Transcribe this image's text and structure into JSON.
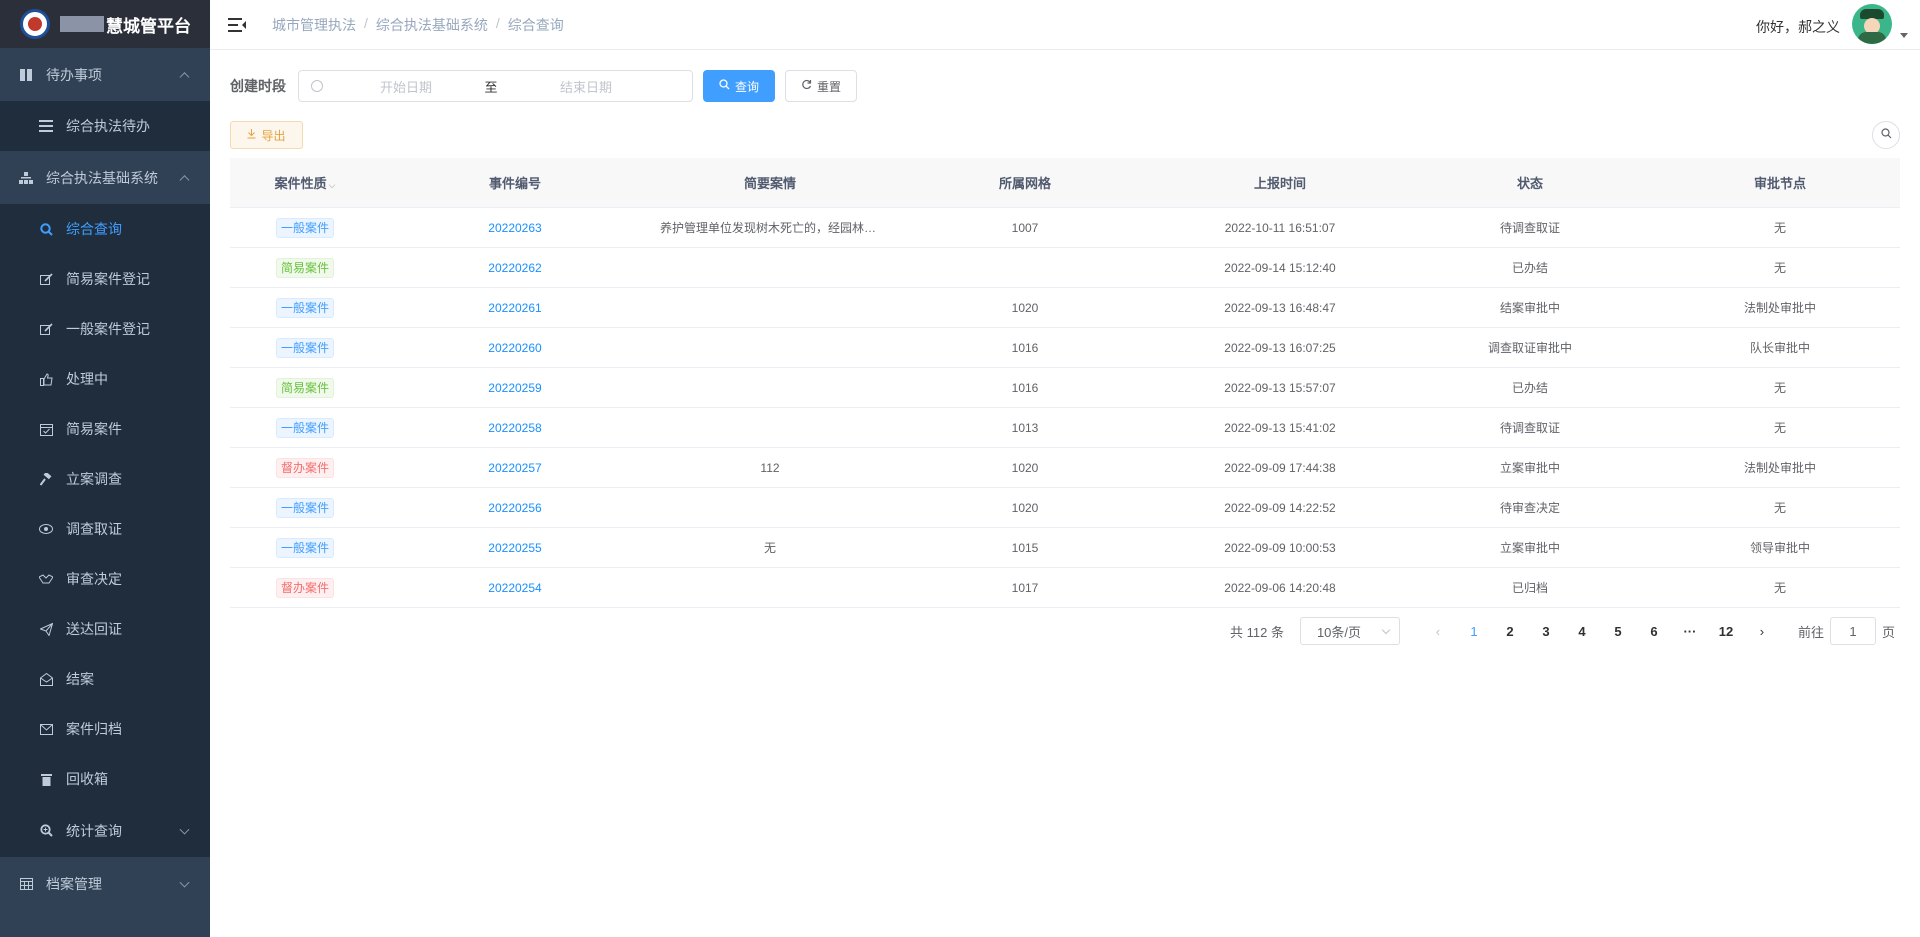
{
  "app": {
    "title": "慧城管平台"
  },
  "sidebar": {
    "groups": [
      {
        "label": "待办事项",
        "icon": "columns-icon",
        "expanded": true
      },
      {
        "label": "综合执法基础系统",
        "icon": "sitemap-icon",
        "expanded": true
      },
      {
        "label": "统计查询",
        "icon": "zoom-icon",
        "expanded": false
      },
      {
        "label": "档案管理",
        "icon": "calendar-icon",
        "expanded": false
      }
    ],
    "pending_items": [
      {
        "label": "综合执法待办",
        "icon": "list-icon"
      }
    ],
    "system_items": [
      {
        "label": "综合查询",
        "icon": "search-icon",
        "active": true
      },
      {
        "label": "简易案件登记",
        "icon": "edit-icon"
      },
      {
        "label": "一般案件登记",
        "icon": "edit-icon"
      },
      {
        "label": "处理中",
        "icon": "thumbs-up-icon"
      },
      {
        "label": "简易案件",
        "icon": "calendar-check-icon"
      },
      {
        "label": "立案调查",
        "icon": "gavel-icon"
      },
      {
        "label": "调查取证",
        "icon": "eye-icon"
      },
      {
        "label": "审查决定",
        "icon": "handshake-icon"
      },
      {
        "label": "送达回证",
        "icon": "paper-plane-icon"
      },
      {
        "label": "结案",
        "icon": "envelope-open-icon"
      },
      {
        "label": "案件归档",
        "icon": "envelope-icon"
      },
      {
        "label": "回收箱",
        "icon": "trash-icon"
      }
    ]
  },
  "header": {
    "breadcrumb": [
      "城市管理执法",
      "综合执法基础系统",
      "综合查询"
    ],
    "greeting": "你好，郝之义"
  },
  "filter": {
    "label": "创建时段",
    "start_placeholder": "开始日期",
    "range_separator": "至",
    "end_placeholder": "结束日期",
    "search_label": "查询",
    "reset_label": "重置"
  },
  "toolbar": {
    "export_label": "导出"
  },
  "table": {
    "headers": [
      "案件性质",
      "事件编号",
      "简要案情",
      "所属网格",
      "上报时间",
      "状态",
      "审批节点"
    ],
    "rows": [
      {
        "type": "一般案件",
        "type_color": "blue",
        "id": "20220263",
        "brief": "养护管理单位发现树木死亡的，经园林绿...",
        "grid": "1007",
        "time": "2022-10-11 16:51:07",
        "status": "待调查取证",
        "node": "无"
      },
      {
        "type": "简易案件",
        "type_color": "green",
        "id": "20220262",
        "brief": "",
        "grid": "",
        "time": "2022-09-14 15:12:40",
        "status": "已办结",
        "node": "无"
      },
      {
        "type": "一般案件",
        "type_color": "blue",
        "id": "20220261",
        "brief": "",
        "grid": "1020",
        "time": "2022-09-13 16:48:47",
        "status": "结案审批中",
        "node": "法制处审批中"
      },
      {
        "type": "一般案件",
        "type_color": "blue",
        "id": "20220260",
        "brief": "",
        "grid": "1016",
        "time": "2022-09-13 16:07:25",
        "status": "调查取证审批中",
        "node": "队长审批中"
      },
      {
        "type": "简易案件",
        "type_color": "green",
        "id": "20220259",
        "brief": "",
        "grid": "1016",
        "time": "2022-09-13 15:57:07",
        "status": "已办结",
        "node": "无"
      },
      {
        "type": "一般案件",
        "type_color": "blue",
        "id": "20220258",
        "brief": "",
        "grid": "1013",
        "time": "2022-09-13 15:41:02",
        "status": "待调查取证",
        "node": "无"
      },
      {
        "type": "督办案件",
        "type_color": "red",
        "id": "20220257",
        "brief": "112",
        "grid": "1020",
        "time": "2022-09-09 17:44:38",
        "status": "立案审批中",
        "node": "法制处审批中"
      },
      {
        "type": "一般案件",
        "type_color": "blue",
        "id": "20220256",
        "brief": "",
        "grid": "1020",
        "time": "2022-09-09 14:22:52",
        "status": "待审查决定",
        "node": "无"
      },
      {
        "type": "一般案件",
        "type_color": "blue",
        "id": "20220255",
        "brief": "无",
        "grid": "1015",
        "time": "2022-09-09 10:00:53",
        "status": "立案审批中",
        "node": "领导审批中"
      },
      {
        "type": "督办案件",
        "type_color": "red",
        "id": "20220254",
        "brief": "",
        "grid": "1017",
        "time": "2022-09-06 14:20:48",
        "status": "已归档",
        "node": "无"
      }
    ]
  },
  "pagination": {
    "total_text": "共 112 条",
    "page_size": "10条/页",
    "pages": [
      "1",
      "2",
      "3",
      "4",
      "5",
      "6",
      "···",
      "12"
    ],
    "current_page": "1",
    "goto_prefix": "前往",
    "goto_value": "1",
    "goto_suffix": "页"
  }
}
